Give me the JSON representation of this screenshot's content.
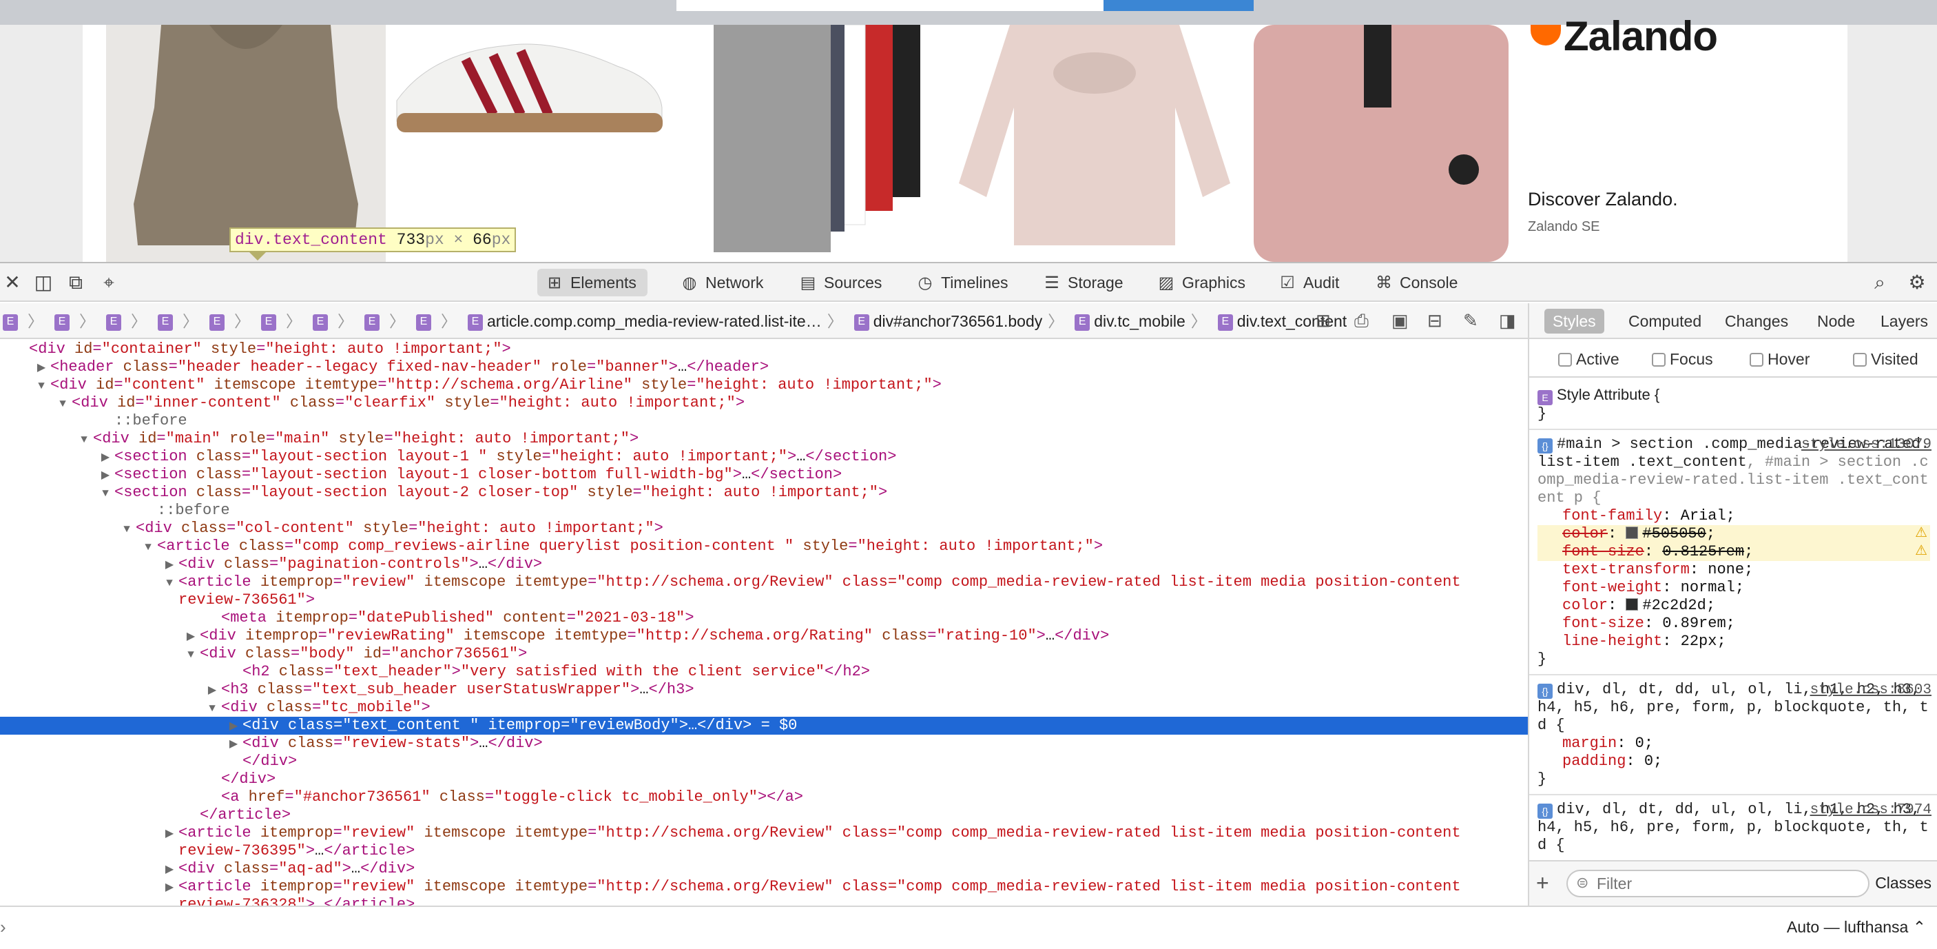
{
  "page": {
    "highlight_tip": {
      "selector": "div.text_content",
      "width": "733",
      "height": "66",
      "unit": "px",
      "times": "×"
    },
    "promo": {
      "logo_text": "Zalando",
      "title": "Discover Zalando.",
      "subtitle": "Zalando SE"
    }
  },
  "devtools": {
    "toolbar": {
      "close_icon": "close-icon",
      "tabs": [
        {
          "label": "Elements",
          "icon": "elements-icon",
          "active": true
        },
        {
          "label": "Network",
          "icon": "network-icon"
        },
        {
          "label": "Sources",
          "icon": "sources-icon"
        },
        {
          "label": "Timelines",
          "icon": "timelines-icon"
        },
        {
          "label": "Storage",
          "icon": "storage-icon"
        },
        {
          "label": "Graphics",
          "icon": "graphics-icon"
        },
        {
          "label": "Audit",
          "icon": "audit-icon"
        },
        {
          "label": "Console",
          "icon": "console-icon"
        }
      ]
    },
    "breadcrumbs": {
      "tail": [
        "article.comp.comp_media-review-rated.list-ite…",
        "div#anchor736561.body",
        "div.tc_mobile",
        "div.text_content"
      ],
      "badge": "E"
    },
    "dom_lines": [
      {
        "indent": 2,
        "tw": "",
        "text": "<div id=\"container\" style=\"height: auto !important;\">"
      },
      {
        "indent": 3,
        "tw": "▶",
        "text": "<header class=\"header header--legacy fixed-nav-header\" role=\"banner\">…</header>"
      },
      {
        "indent": 3,
        "tw": "▼",
        "text": "<div id=\"content\" itemscope itemtype=\"http://schema.org/Airline\" style=\"height: auto !important;\">"
      },
      {
        "indent": 4,
        "tw": "▼",
        "text": "<div id=\"inner-content\" class=\"clearfix\" style=\"height: auto !important;\">"
      },
      {
        "indent": 6,
        "tw": "",
        "text": "::before"
      },
      {
        "indent": 5,
        "tw": "▼",
        "text": "<div id=\"main\" role=\"main\" style=\"height: auto !important;\">"
      },
      {
        "indent": 6,
        "tw": "▶",
        "text": "<section class=\"layout-section layout-1 \" style=\"height: auto !important;\">…</section>"
      },
      {
        "indent": 6,
        "tw": "▶",
        "text": "<section class=\"layout-section layout-1 closer-bottom full-width-bg\">…</section>"
      },
      {
        "indent": 6,
        "tw": "▼",
        "text": "<section class=\"layout-section layout-2 closer-top\" style=\"height: auto !important;\">"
      },
      {
        "indent": 8,
        "tw": "",
        "text": "::before"
      },
      {
        "indent": 7,
        "tw": "▼",
        "text": "<div class=\"col-content\" style=\"height: auto !important;\">"
      },
      {
        "indent": 8,
        "tw": "▼",
        "text": "<article class=\"comp comp_reviews-airline querylist position-content \" style=\"height: auto !important;\">"
      },
      {
        "indent": 9,
        "tw": "▶",
        "text": "<div class=\"pagination-controls\">…</div>"
      },
      {
        "indent": 9,
        "tw": "▼",
        "text": "<article itemprop=\"review\" itemscope itemtype=\"http://schema.org/Review\" class=\"comp comp_media-review-rated list-item media position-content"
      },
      {
        "indent": 9,
        "tw": "",
        "text": "review-736561\">"
      },
      {
        "indent": 11,
        "tw": "",
        "text": "<meta itemprop=\"datePublished\" content=\"2021-03-18\">"
      },
      {
        "indent": 10,
        "tw": "▶",
        "text": "<div itemprop=\"reviewRating\" itemscope itemtype=\"http://schema.org/Rating\" class=\"rating-10\">…</div>"
      },
      {
        "indent": 10,
        "tw": "▼",
        "text": "<div class=\"body\" id=\"anchor736561\">"
      },
      {
        "indent": 12,
        "tw": "",
        "text": "<h2 class=\"text_header\">\"very satisfied with the client service\"</h2>"
      },
      {
        "indent": 11,
        "tw": "▶",
        "text": "<h3 class=\"text_sub_header userStatusWrapper\">…</h3>"
      },
      {
        "indent": 11,
        "tw": "▼",
        "text": "<div class=\"tc_mobile\">"
      },
      {
        "indent": 12,
        "tw": "▶",
        "text": "<div class=\"text_content \" itemprop=\"reviewBody\">…</div> = $0",
        "selected": true
      },
      {
        "indent": 12,
        "tw": "▶",
        "text": "<div class=\"review-stats\">…</div>"
      },
      {
        "indent": 12,
        "tw": "",
        "text": "</div>"
      },
      {
        "indent": 11,
        "tw": "",
        "text": "</div>"
      },
      {
        "indent": 11,
        "tw": "",
        "text": "<a href=\"#anchor736561\" class=\"toggle-click tc_mobile_only\"></a>"
      },
      {
        "indent": 10,
        "tw": "",
        "text": "</article>"
      },
      {
        "indent": 9,
        "tw": "▶",
        "text": "<article itemprop=\"review\" itemscope itemtype=\"http://schema.org/Review\" class=\"comp comp_media-review-rated list-item media position-content"
      },
      {
        "indent": 9,
        "tw": "",
        "text": "review-736395\">…</article>"
      },
      {
        "indent": 9,
        "tw": "▶",
        "text": "<div class=\"aq-ad\">…</div>"
      },
      {
        "indent": 9,
        "tw": "▶",
        "text": "<article itemprop=\"review\" itemscope itemtype=\"http://schema.org/Review\" class=\"comp comp_media-review-rated list-item media position-content"
      },
      {
        "indent": 9,
        "tw": "",
        "text": "review-736328\">…</article>"
      }
    ],
    "sidebar": {
      "tabs": [
        "Styles",
        "Computed",
        "Changes",
        "Node",
        "Layers"
      ],
      "pseudo": [
        "Active",
        "Focus",
        "Hover",
        "Visited"
      ],
      "style_attribute": "Style Attribute {",
      "rule1": {
        "selector": "#main > section .comp_media-review-rated.list-item .text_content",
        "selector_dim": ", #main > section .comp_media-review-rated.list-item .text_content p {",
        "source": "style.css:13079",
        "props": [
          {
            "name": "font-family",
            "value": "Arial"
          },
          {
            "name": "color",
            "value": "#505050",
            "swatch": "#505050",
            "struck": true,
            "warn": true
          },
          {
            "name": "font-size",
            "value": "0.8125rem",
            "struck": true,
            "warn": true
          },
          {
            "name": "text-transform",
            "value": "none"
          },
          {
            "name": "font-weight",
            "value": "normal"
          },
          {
            "name": "color",
            "value": "#2c2d2d",
            "swatch": "#2c2d2d"
          },
          {
            "name": "font-size",
            "value": "0.89rem"
          },
          {
            "name": "line-height",
            "value": "22px"
          }
        ]
      },
      "rule2": {
        "selector": "div, dl, dt, dd, ul, ol, li, h1, h2, h3, h4, h5, h6, pre, form, p, blockquote, th, td {",
        "source": "style.css:8603",
        "props": [
          {
            "name": "margin",
            "value": "0"
          },
          {
            "name": "padding",
            "value": "0"
          }
        ]
      },
      "rule3": {
        "selector": "div, dl, dt, dd, ul, ol, li, h1, h2, h3, h4, h5, h6, pre, form, p, blockquote, th, td {",
        "source": "style.css:7974"
      },
      "filter_placeholder": "Filter",
      "classes_label": "Classes",
      "add_label": "+"
    },
    "console": {
      "prompt": "›",
      "context": "Auto — lufthansa ⌃"
    }
  }
}
